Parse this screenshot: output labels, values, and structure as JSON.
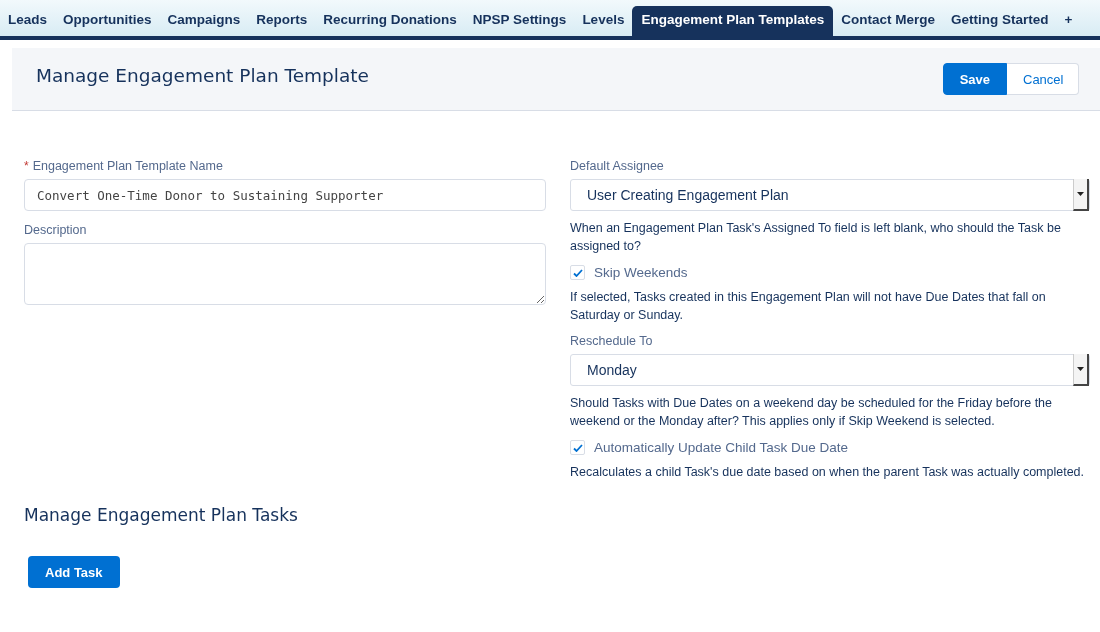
{
  "tabs": [
    {
      "label": "Leads",
      "selected": false
    },
    {
      "label": "Opportunities",
      "selected": false
    },
    {
      "label": "Campaigns",
      "selected": false
    },
    {
      "label": "Reports",
      "selected": false
    },
    {
      "label": "Recurring Donations",
      "selected": false
    },
    {
      "label": "NPSP Settings",
      "selected": false
    },
    {
      "label": "Levels",
      "selected": false
    },
    {
      "label": "Engagement Plan Templates",
      "selected": true
    },
    {
      "label": "Contact Merge",
      "selected": false
    },
    {
      "label": "Getting Started",
      "selected": false
    },
    {
      "label": "+",
      "selected": false
    }
  ],
  "header": {
    "title": "Manage Engagement Plan Template",
    "buttons": [
      {
        "label": "Save",
        "kind": "primary"
      },
      {
        "label": "Cancel",
        "kind": "neutral"
      }
    ]
  },
  "left_fields": [
    {
      "kind": "input",
      "label": "Engagement Plan Template Name",
      "required": true,
      "required_mark": "*",
      "value": "Convert One-Time Donor to Sustaining Supporter"
    },
    {
      "kind": "textarea",
      "label": "Description",
      "required": false
    }
  ],
  "right_fields": [
    {
      "kind": "select",
      "label": "Default Assignee",
      "value": "User Creating Engagement Plan",
      "help": "When an Engagement Plan Task's Assigned To field is left blank, who should the Task be assigned to?"
    },
    {
      "kind": "checkbox",
      "label": "Skip Weekends",
      "checked": true,
      "help": "If selected, Tasks created in this Engagement Plan will not have Due Dates that fall on Saturday or Sunday."
    },
    {
      "kind": "select",
      "label": "Reschedule To",
      "value": "Monday",
      "help": "Should Tasks with Due Dates on a weekend day be scheduled for the Friday before the weekend or the Monday after? This applies only if Skip Weekend is selected."
    },
    {
      "kind": "checkbox",
      "label": "Automatically Update Child Task Due Date",
      "checked": true,
      "help": "Recalculates a child Task's due date based on when the parent Task was actually completed."
    }
  ],
  "tasks_section": {
    "title": "Manage Engagement Plan Tasks",
    "button": "Add Task"
  }
}
